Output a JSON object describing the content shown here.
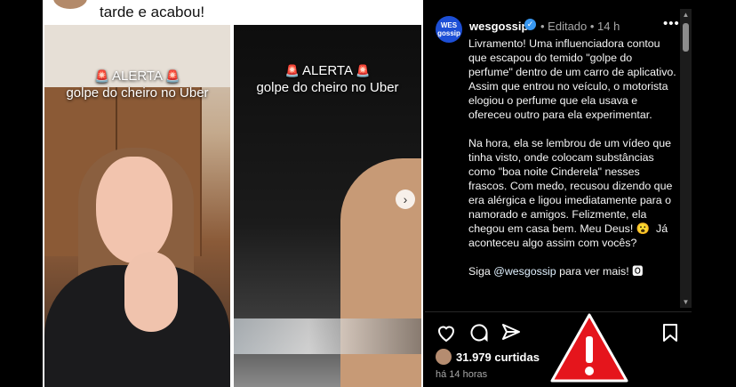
{
  "left_post": {
    "header_text": "tarde e acabou!",
    "alerts": [
      {
        "title": "ALERTA",
        "subtitle": "golpe do cheiro no Uber"
      },
      {
        "title": "ALERTA",
        "subtitle": "golpe do cheiro no Uber"
      }
    ],
    "carousel_next_icon": "chevron-right-icon"
  },
  "right_post": {
    "username": "wesgossip",
    "avatar_text": "WES gossip",
    "meta": "• Editado • 14 h",
    "menu": "•••",
    "caption_p1": "Livramento! Uma influenciadora contou que escapou do temido \"golpe do perfume\" dentro de um carro de aplicativo. Assim que entrou no veículo, o motorista elogiou o perfume que ela usava e ofereceu outro para ela experimentar.",
    "caption_p2": "Na hora, ela se lembrou de um vídeo que tinha visto, onde colocam substâncias como \"boa noite Cinderela\" nesses frascos. Com medo, recusou dizendo que era alérgica e ligou imediatamente para o namorado e amigos. Felizmente, ela chegou em casa bem. Meu Deus! 😮  Já aconteceu algo assim com vocês?",
    "caption_p3_pre": "Siga ",
    "caption_p3_mention": "@wesgossip",
    "caption_p3_post": " para ver mais! 🅾",
    "likes": "31.979 curtidas",
    "time_ago": "há 14 horas",
    "icons": [
      "heart-icon",
      "comment-icon",
      "share-icon",
      "bookmark-icon"
    ]
  },
  "colors": {
    "warning_red": "#e5151c",
    "verified_blue": "#3897f0",
    "avatar_blue": "#1d4fd6"
  }
}
